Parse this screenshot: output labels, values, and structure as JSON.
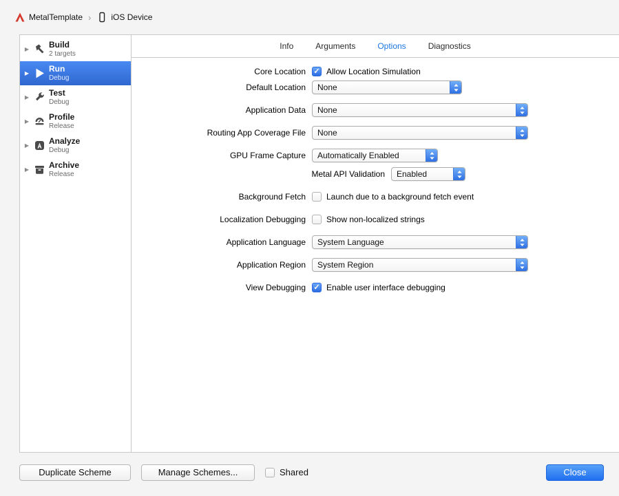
{
  "colors": {
    "accent_blue": "#1c76e2",
    "selection_blue": "#3874d7",
    "close_button_blue": "#1f6ff0"
  },
  "breadcrumb": {
    "scheme_name": "MetalTemplate",
    "separator": "›",
    "destination": "iOS Device"
  },
  "sidebar": {
    "selected_index": 1,
    "items": [
      {
        "label": "Build",
        "sublabel": "2 targets",
        "icon": "hammer-icon"
      },
      {
        "label": "Run",
        "sublabel": "Debug",
        "icon": "play-icon"
      },
      {
        "label": "Test",
        "sublabel": "Debug",
        "icon": "wrench-icon"
      },
      {
        "label": "Profile",
        "sublabel": "Release",
        "icon": "gauge-icon"
      },
      {
        "label": "Analyze",
        "sublabel": "Debug",
        "icon": "analyze-a-icon"
      },
      {
        "label": "Archive",
        "sublabel": "Release",
        "icon": "archive-box-icon"
      }
    ]
  },
  "tabs": {
    "active_index": 2,
    "items": [
      {
        "label": "Info"
      },
      {
        "label": "Arguments"
      },
      {
        "label": "Options"
      },
      {
        "label": "Diagnostics"
      }
    ]
  },
  "options_form": {
    "core_location": {
      "label": "Core Location",
      "checkbox_label": "Allow Location Simulation",
      "checked": true
    },
    "default_location": {
      "label": "Default Location",
      "value": "None"
    },
    "application_data": {
      "label": "Application Data",
      "value": "None"
    },
    "routing_app_coverage_file": {
      "label": "Routing App Coverage File",
      "value": "None"
    },
    "gpu_frame_capture": {
      "label": "GPU Frame Capture",
      "value": "Automatically Enabled"
    },
    "metal_api_validation": {
      "label": "Metal API Validation",
      "value": "Enabled"
    },
    "background_fetch": {
      "label": "Background Fetch",
      "checkbox_label": "Launch due to a background fetch event",
      "checked": false
    },
    "localization_debugging": {
      "label": "Localization Debugging",
      "checkbox_label": "Show non-localized strings",
      "checked": false
    },
    "application_language": {
      "label": "Application Language",
      "value": "System Language"
    },
    "application_region": {
      "label": "Application Region",
      "value": "System Region"
    },
    "view_debugging": {
      "label": "View Debugging",
      "checkbox_label": "Enable user interface debugging",
      "checked": true
    }
  },
  "footer": {
    "duplicate_scheme_label": "Duplicate Scheme",
    "manage_schemes_label": "Manage Schemes...",
    "shared_label": "Shared",
    "shared_checked": false,
    "close_label": "Close"
  }
}
